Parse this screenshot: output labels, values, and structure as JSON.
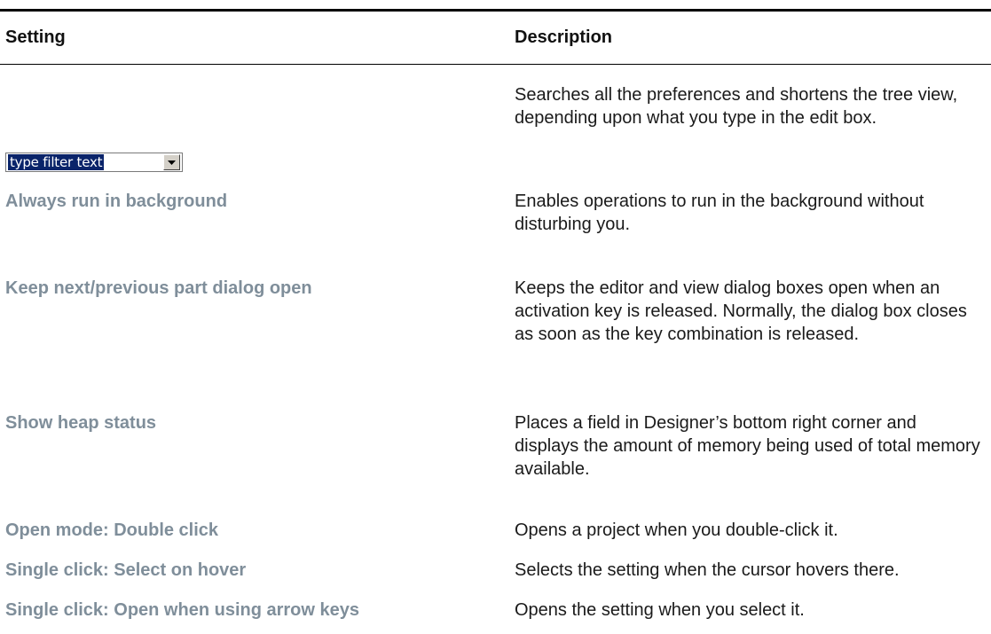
{
  "table": {
    "headers": {
      "setting": "Setting",
      "description": "Description"
    },
    "filter_row": {
      "filter_value": "type filter text",
      "description": "Searches all the preferences and shortens the tree view, depending upon what you type in the edit box."
    },
    "rows": [
      {
        "setting": "Always run in background",
        "description": "Enables operations to run in the background without disturbing you."
      },
      {
        "setting": "Keep next/previous part dialog open",
        "description": "Keeps the editor and view dialog boxes open when an activation key is released. Normally, the dialog box closes as soon as the key combination is released."
      },
      {
        "setting": "Show heap status",
        "description": "Places a field in Designer’s bottom right corner and displays the amount of memory being used of total memory available."
      },
      {
        "setting": "Open mode: Double click",
        "description": "Opens a project when you double-click it."
      },
      {
        "setting": "Single click: Select on hover",
        "description": "Selects the setting when the cursor hovers there."
      },
      {
        "setting": "Single click: Open when using arrow keys",
        "description": "Opens the setting when you select it."
      }
    ]
  },
  "colors": {
    "setting_label": "#7f8e9a",
    "rule": "#000000",
    "selection": "#0a246a"
  },
  "icons": {
    "dropdown": "chevron-down-icon"
  }
}
